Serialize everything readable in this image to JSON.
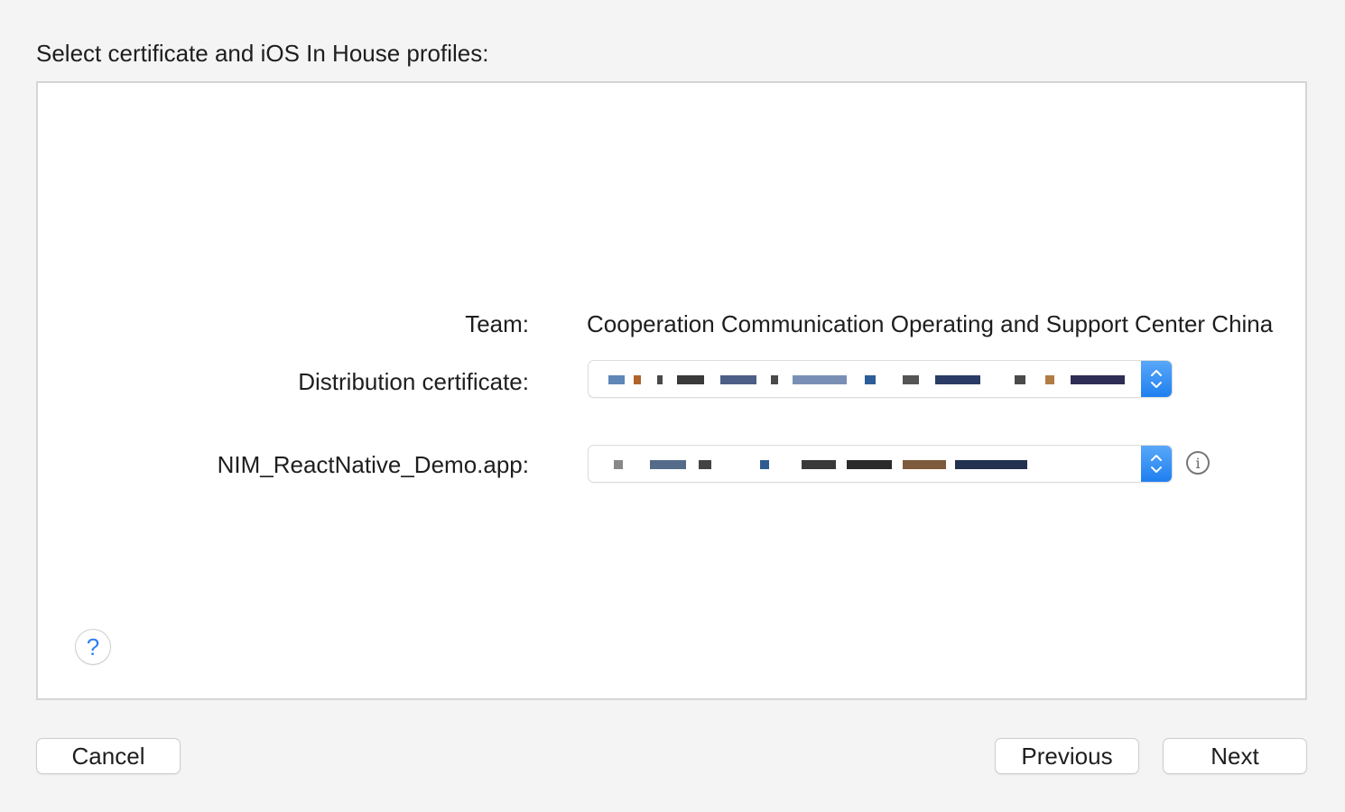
{
  "dialog": {
    "heading": "Select certificate and iOS In House profiles:"
  },
  "form": {
    "team_label": "Team:",
    "team_value": "Cooperation Communication Operating and Support Center China",
    "certificate_label": "Distribution certificate:",
    "profile_label": "NIM_ReactNative_Demo.app:"
  },
  "icons": {
    "help": "?",
    "info": "i"
  },
  "buttons": {
    "cancel": "Cancel",
    "previous": "Previous",
    "next": "Next"
  },
  "colors": {
    "accent": "#1f7ff0",
    "background": "#f4f4f4",
    "panel": "#ffffff"
  }
}
